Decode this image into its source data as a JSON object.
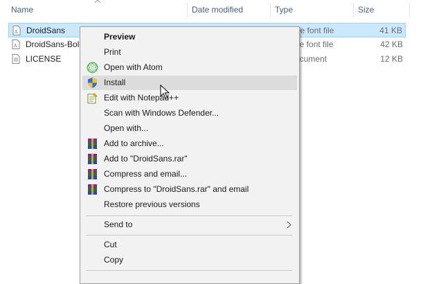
{
  "columns": {
    "name": "Name",
    "date_modified": "Date modified",
    "type": "Type",
    "size": "Size"
  },
  "files": [
    {
      "name": "DroidSans",
      "type": "pe font file",
      "size": "41 KB",
      "icon": "font-file-icon",
      "selected": true
    },
    {
      "name": "DroidSans-Bold",
      "type": "pe font file",
      "size": "42 KB",
      "icon": "font-file-icon",
      "selected": false
    },
    {
      "name": "LICENSE",
      "type": "ocument",
      "size": "12 KB",
      "icon": "text-document-icon",
      "selected": false
    }
  ],
  "context_menu": {
    "items": [
      {
        "label": "Preview",
        "bold": true
      },
      {
        "label": "Print"
      },
      {
        "label": "Open with Atom",
        "icon": "atom-icon"
      },
      {
        "label": "Install",
        "icon": "uac-shield-icon",
        "hover": true
      },
      {
        "label": "Edit with Notepad++",
        "icon": "notepad-plus-plus-icon"
      },
      {
        "label": "Scan with Windows Defender..."
      },
      {
        "label": "Open with..."
      },
      {
        "label": "Add to archive...",
        "icon": "winrar-icon"
      },
      {
        "label": "Add to \"DroidSans.rar\"",
        "icon": "winrar-icon"
      },
      {
        "label": "Compress and email...",
        "icon": "winrar-icon"
      },
      {
        "label": "Compress to \"DroidSans.rar\" and email",
        "icon": "winrar-icon"
      },
      {
        "label": "Restore previous versions"
      },
      {
        "label": "Send to",
        "submenu": true
      },
      {
        "label": "Cut"
      },
      {
        "label": "Copy"
      }
    ]
  },
  "colors": {
    "selection_bg": "#cce8ff",
    "selection_border": "#99d1ff",
    "menu_bg": "#f2f2f2",
    "menu_hover": "#dcdcdc"
  }
}
